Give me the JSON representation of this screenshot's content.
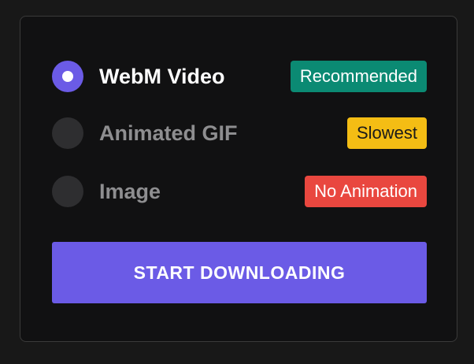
{
  "options": [
    {
      "label": "WebM Video",
      "badge": "Recommended",
      "badge_color": "#0b8a73",
      "selected": true
    },
    {
      "label": "Animated GIF",
      "badge": "Slowest",
      "badge_color": "#f4bd14",
      "selected": false
    },
    {
      "label": "Image",
      "badge": "No Animation",
      "badge_color": "#e9473f",
      "selected": false
    }
  ],
  "start_button": {
    "label": "START DOWNLOADING"
  },
  "colors": {
    "accent": "#6b5be6",
    "background": "#181818",
    "panel": "#111112"
  }
}
